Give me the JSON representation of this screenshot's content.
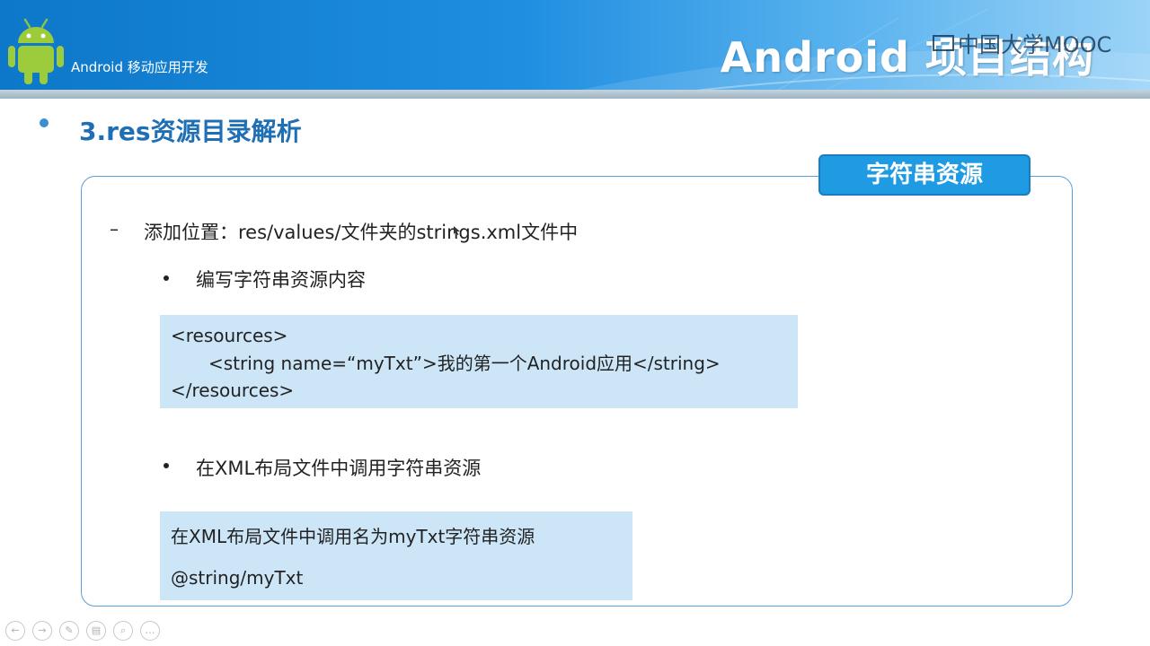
{
  "header": {
    "course_title": "Android 移动应用开发",
    "slide_title": "Android 项目结构",
    "watermark": "中国大学MOOC"
  },
  "section": {
    "title": "3.res资源目录解析"
  },
  "tag": {
    "label": "字符串资源"
  },
  "content": {
    "dash": "–",
    "line1": "添加位置：res/values/文件夹的strings.xml文件中",
    "sub1": "编写字符串资源内容",
    "code1": {
      "line1": "<resources>",
      "line2": "<string name=“myTxt”>我的第一个Android应用</string>",
      "line3": "</resources>"
    },
    "sub2": "在XML布局文件中调用字符串资源",
    "code2": {
      "line1": "在XML布局文件中调用名为myTxt字符串资源",
      "line2": "@string/myTxt"
    }
  },
  "toolbar": {
    "buttons": [
      {
        "icon": "previous-icon",
        "glyph": "←"
      },
      {
        "icon": "next-icon",
        "glyph": "→"
      },
      {
        "icon": "pen-icon",
        "glyph": "✎"
      },
      {
        "icon": "slides-icon",
        "glyph": "▤"
      },
      {
        "icon": "zoom-icon",
        "glyph": "⌕"
      },
      {
        "icon": "more-icon",
        "glyph": "…"
      }
    ]
  },
  "colors": {
    "banner": "#1f8ee0",
    "heading": "#1f6fb5",
    "frame_border": "#5a9fd8",
    "tag_bg": "#1e9be2",
    "code_bg": "#cce6f8"
  }
}
